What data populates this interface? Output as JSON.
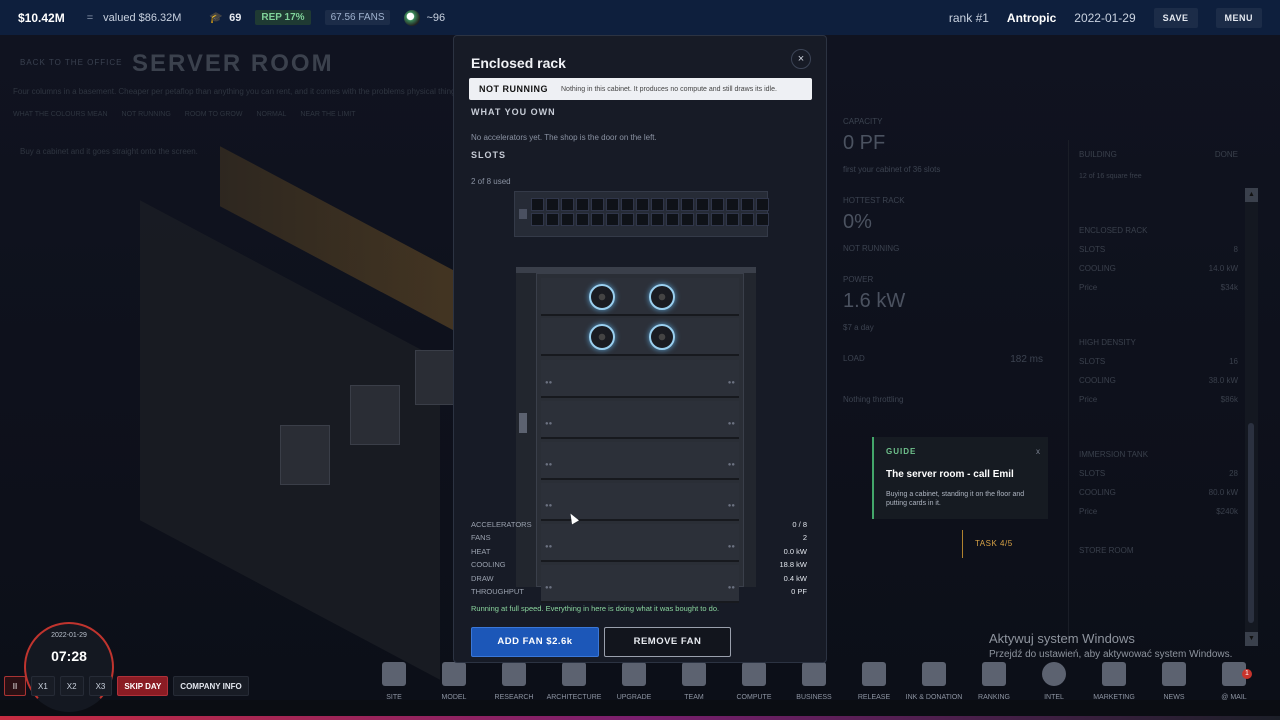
{
  "topbar": {
    "money": "$10.42M",
    "eq": "=",
    "valued": "valued $86.32M",
    "grads": "69",
    "rep": "REP 17%",
    "fans": "67.56 FANS",
    "avatar_count": "~96",
    "rank": "rank #1",
    "company": "Antropic",
    "date": "2022-01-29",
    "save": "SAVE",
    "menu": "MENU"
  },
  "background": {
    "back": "BACK TO THE OFFICE",
    "title": "SERVER ROOM",
    "desc": "Four columns in a basement. Cheaper per petaflop than anything you can rent, and it comes with the problems physical things have.",
    "legend_label": "WHAT THE COLOURS MEAN",
    "legend": [
      "NOT RUNNING",
      "ROOM TO GROW",
      "NORMAL",
      "NEAR THE LIMIT"
    ],
    "hint": "Buy a cabinet and it goes straight onto the screen."
  },
  "stats": {
    "capacity_label": "CAPACITY",
    "capacity": "0 PF",
    "capacity_sub": "first your cabinet of 36 slots",
    "hottest_label": "HOTTEST RACK",
    "hottest": "0%",
    "hottest_sub": "NOT RUNNING",
    "power_label": "POWER",
    "power": "1.6 kW",
    "power_sub": "$7 a day",
    "load_label": "LOAD",
    "load_value": "182 ms",
    "throttle": "Nothing throttling"
  },
  "shop": {
    "header": "BUILDING",
    "done": "DONE",
    "sub": "12 of 16 square free",
    "items": [
      {
        "name": "ENCLOSED RACK",
        "slots": "8",
        "cooling": "14.0 kW",
        "price": "$34k"
      },
      {
        "name": "HIGH DENSITY",
        "slots": "16",
        "cooling": "38.0 kW",
        "price": "$86k"
      },
      {
        "name": "IMMERSION TANK",
        "slots": "28",
        "cooling": "80.0 kW",
        "price": "$240k"
      }
    ],
    "slots_label": "SLOTS",
    "cooling_label": "COOLING",
    "price_label": "Price",
    "storage": "STORE ROOM"
  },
  "guide": {
    "label": "GUIDE",
    "close": "x",
    "title": "The server room - call Emil",
    "desc": "Buying a cabinet, standing it on the floor and putting cards in it."
  },
  "task": "TASK 4/5",
  "watermark": {
    "line1": "Aktywuj system Windows",
    "line2": "Przejdź do ustawień, aby aktywować system Windows."
  },
  "clock": {
    "date": "2022-01-29",
    "time": "07:28"
  },
  "speed": {
    "pause": "II",
    "x1": "X1",
    "x2": "X2",
    "x3": "X3",
    "skip": "SKIP DAY",
    "info": "COMPANY INFO"
  },
  "dock": [
    {
      "label": "SITE",
      "icon": "site-icon"
    },
    {
      "label": "MODEL",
      "icon": "model-icon"
    },
    {
      "label": "RESEARCH",
      "icon": "research-icon"
    },
    {
      "label": "ARCHITECTURE",
      "icon": "architecture-icon"
    },
    {
      "label": "UPGRADE",
      "icon": "upgrade-icon"
    },
    {
      "label": "TEAM",
      "icon": "team-icon"
    },
    {
      "label": "COMPUTE",
      "icon": "compute-icon"
    },
    {
      "label": "BUSINESS",
      "icon": "business-icon"
    },
    {
      "label": "RELEASE",
      "icon": "release-icon"
    },
    {
      "label": "INK & DONATION",
      "icon": "donation-icon"
    },
    {
      "label": "RANKING",
      "icon": "ranking-icon"
    },
    {
      "label": "INTEL",
      "icon": "intel-icon"
    },
    {
      "label": "MARKETING",
      "icon": "marketing-icon"
    },
    {
      "label": "NEWS",
      "icon": "news-icon"
    },
    {
      "label": "@ MAIL",
      "icon": "mail-icon",
      "badge": "1"
    }
  ],
  "modal": {
    "title": "Enclosed rack",
    "close": "×",
    "status": "NOT RUNNING",
    "status_desc": "Nothing in this cabinet. It produces no compute and still draws its idle.",
    "own_header": "WHAT YOU OWN",
    "own_text": "No accelerators yet. The shop is the door on the left.",
    "slots_header": "SLOTS",
    "slots_used": "2 of 8 used",
    "stats": [
      {
        "label": "ACCELERATORS",
        "value": "0 / 8"
      },
      {
        "label": "FANS",
        "value": "2"
      },
      {
        "label": "HEAT",
        "value": "0.0 kW"
      },
      {
        "label": "COOLING",
        "value": "18.8 kW"
      },
      {
        "label": "DRAW",
        "value": "0.4 kW"
      },
      {
        "label": "THROUGHPUT",
        "value": "0 PF"
      }
    ],
    "running": "Running at full speed. Everything in here is doing what it was bought to do.",
    "add_fan": "ADD FAN $2.6k",
    "remove_fan": "REMOVE FAN"
  }
}
